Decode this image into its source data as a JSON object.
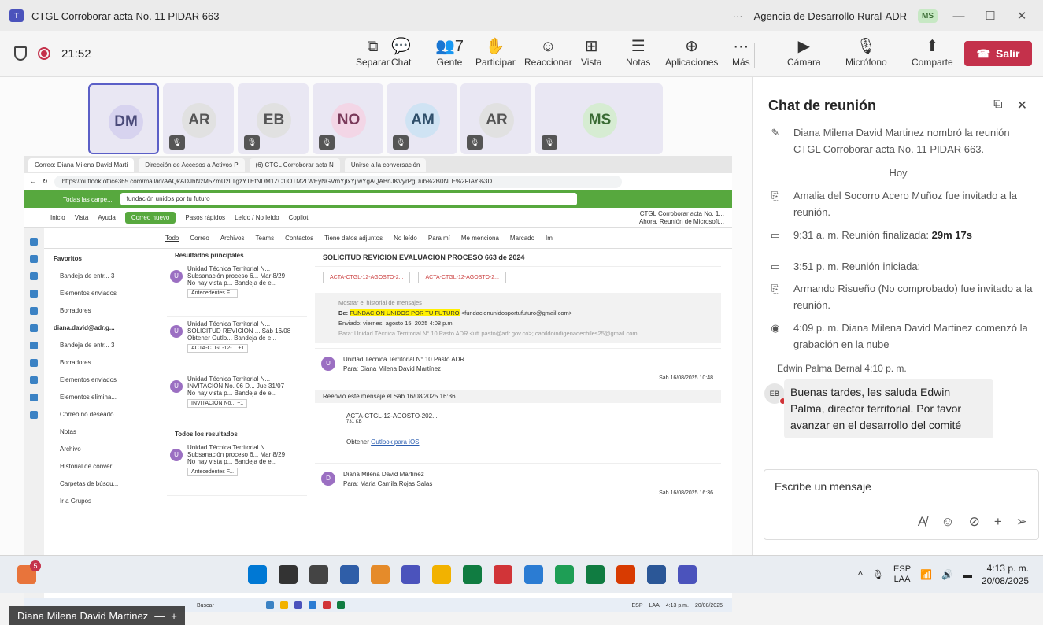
{
  "window": {
    "title": "CTGL Corroborar acta No. 11 PIDAR 663",
    "more": "···",
    "org": "Agencia de Desarrollo Rural-ADR",
    "user_initials": "MS",
    "minimize": "—",
    "maximize": "☐",
    "close": "✕"
  },
  "toolbar": {
    "time": "21:52",
    "buttons": [
      {
        "icon": "⧉",
        "label": "Separar"
      },
      {
        "icon": "💬",
        "label": "Chat"
      },
      {
        "icon": "👥7",
        "label": "Gente"
      },
      {
        "icon": "✋",
        "label": "Participar"
      },
      {
        "icon": "☺",
        "label": "Reaccionar"
      },
      {
        "icon": "⊞",
        "label": "Vista"
      },
      {
        "icon": "☰",
        "label": "Notas"
      },
      {
        "icon": "⊕",
        "label": "Aplicaciones"
      },
      {
        "icon": "···",
        "label": "Más"
      }
    ],
    "devices": [
      {
        "icon": "▶",
        "label": "Cámara"
      },
      {
        "icon": "🎙",
        "label": "Micrófono"
      },
      {
        "icon": "⬆",
        "label": "Comparte"
      }
    ],
    "leave_label": "Salir",
    "leave_color": "#c4314b"
  },
  "participants": [
    {
      "initials": "DM",
      "bg": "#d7d3ef",
      "fg": "#4b4b7a",
      "muted": false
    },
    {
      "initials": "AR",
      "bg": "#e1e1e1",
      "fg": "#555555",
      "muted": true
    },
    {
      "initials": "EB",
      "bg": "#e1e1e1",
      "fg": "#555555",
      "muted": true
    },
    {
      "initials": "NO",
      "bg": "#f3d6e6",
      "fg": "#7a3a5a",
      "muted": true
    },
    {
      "initials": "AM",
      "bg": "#cfe3f3",
      "fg": "#2f4f6a",
      "muted": true
    },
    {
      "initials": "AR",
      "bg": "#e1e1e1",
      "fg": "#555555",
      "muted": true
    },
    {
      "initials": "MS",
      "bg": "#d6ecd2",
      "fg": "#3a6b34",
      "muted": true
    }
  ],
  "share": {
    "browser_tabs": [
      "Correo: Diana Milena David Marti",
      "Dirección de Accesos a Activos P",
      "(6) CTGL Corroborar acta N",
      "Unirse a la conversación"
    ],
    "url": "https://outlook.office365.com/mail/id/AAQkADJhNzM5ZmUzLTgzYTEtNDM1ZC1iOTM2LWEyNGVmYjIxYjlwYgAQABnJKVyrPgUub%2B0NLE%2FIAY%3D",
    "folder_scope": "Todas las carpe...",
    "search_query": "fundación unidos por tu futuro",
    "meeting_notice": "CTGL Corroborar acta No. 1...",
    "meeting_notice_sub": "Ahora, Reunión de Microsoft...",
    "menu": [
      "Inicio",
      "Vista",
      "Ayuda"
    ],
    "new_mail": "Correo nuevo",
    "ribbon": [
      "Pasos rápidos",
      "Leído / No leído",
      "Copilot"
    ],
    "filters": [
      "Todo",
      "Correo",
      "Archivos",
      "Teams",
      "Contactos",
      "Tiene datos adjuntos",
      "No leído",
      "Para mí",
      "Me menciona",
      "Marcado",
      "Im"
    ],
    "folders": [
      {
        "label": "Favoritos",
        "hdr": true
      },
      {
        "label": "Bandeja de entr...  3"
      },
      {
        "label": "Elementos enviados"
      },
      {
        "label": "Borradores"
      },
      {
        "label": "diana.david@adr.g...",
        "hdr": true
      },
      {
        "label": "Bandeja de entr...  3"
      },
      {
        "label": "Borradores"
      },
      {
        "label": "Elementos enviados"
      },
      {
        "label": "Elementos elimina..."
      },
      {
        "label": "Correo no deseado"
      },
      {
        "label": "Notas"
      },
      {
        "label": "Archivo"
      },
      {
        "label": "Historial de conver..."
      },
      {
        "label": "Carpetas de búsqu..."
      },
      {
        "label": "Ir a Grupos"
      }
    ],
    "results_header": "Resultados principales",
    "all_results_header": "Todos los resultados",
    "mails": [
      {
        "from": "Unidad Técnica Territorial N...",
        "subject": "Subsanación proceso 6...   Mar 8/29",
        "preview": "No hay vista p...   Bandeja de e...",
        "att": "Antecedentes F..."
      },
      {
        "from": "Unidad Técnica Territorial N...",
        "subject": "SOLICITUD REVICION ...   Sáb 16/08",
        "preview": "Obtener Outlo...   Bandeja de e...",
        "att": "ACTA-CTGL-12-...   +1"
      },
      {
        "from": "Unidad Técnica Territorial N...",
        "subject": "INVITACIÓN No. 06 D...   Jue 31/07",
        "preview": "No hay vista p...   Bandeja de e...",
        "att": "INVITACIÓN No...   +1"
      },
      {
        "from": "Unidad Técnica Territorial N...",
        "subject": "Subsanación proceso 6...   Mar 8/29",
        "preview": "No hay vista p...   Bandeja de e...",
        "att": "Antecedentes F..."
      }
    ],
    "reader": {
      "subject": "SOLICITUD REVICION EVALUACION PROCESO 663 de 2024",
      "attachments": [
        "ACTA-CTGL-12-AGOSTO-2...",
        "ACTA-CTGL-12-AGOSTO-2..."
      ],
      "history": "Mostrar el historial de mensajes",
      "from_label": "De:",
      "from_name": "FUNDACION UNIDOS POR TU FUTURO",
      "from_email": "<fundacionunidosportufuturo@gmail.com>",
      "sent": "Enviado: viernes, agosto 15, 2025 4:08 p.m.",
      "to": "Para: Unidad Técnica Territorial N° 10 Pasto ADR <utt.pasto@adr.gov.co>; cabildoindigenadechiles25@gmail.com",
      "msg1_from": "Unidad Técnica Territorial N° 10 Pasto ADR",
      "msg1_to": "Para: Diana Milena David Martínez",
      "msg1_date": "Sáb 16/08/2025 10:48",
      "forward_note": "Reenvió este mensaje el Sáb 16/08/2025 16:36.",
      "msg1_att": "ACTA-CTGL-12-AGOSTO-202...",
      "msg1_att_size": "731 KB",
      "outlook_text": "Obtener",
      "outlook_link": "Outlook para iOS",
      "msg2_from": "Diana Milena David Martínez",
      "msg2_to": "Para: Maria Camila Rojas Salas",
      "msg2_date": "Sáb 16/08/2025 16:36"
    },
    "inner_taskbar": {
      "search": "Buscar",
      "lang": "ESP",
      "region": "LAA",
      "time": "4:13 p.m.",
      "date": "20/08/2025"
    }
  },
  "speaker": {
    "name": "Diana Milena David Martinez"
  },
  "chat": {
    "title": "Chat de reunión",
    "events": [
      {
        "icon": "✎",
        "text": "Diana Milena David Martinez nombró la reunión CTGL Corroborar acta No. 11 PIDAR 663.",
        "bold": ""
      },
      {
        "icon": "⎘",
        "text": "Amalia del Socorro Acero Muñoz fue invitado a la reunión.",
        "bold": ""
      },
      {
        "icon": "▭",
        "text": "9:31 a. m.   Reunión finalizada: ",
        "bold": "29m 17s"
      },
      {
        "icon": "▭",
        "text": "3:51 p. m.   Reunión iniciada:",
        "bold": ""
      },
      {
        "icon": "⎘",
        "text": "Armando Risueño (No comprobado) fue invitado a la reunión.",
        "bold": ""
      },
      {
        "icon": "◉",
        "text": "4:09 p. m.   Diana Milena David Martinez comenzó la grabación en la nube",
        "bold": ""
      }
    ],
    "today": "Hoy",
    "sender": "Edwin Palma Bernal   4:10 p. m.",
    "sender_initials": "EB",
    "message": "Buenas tardes, les saluda Edwin Palma, director territorial. Por favor avanzar en el desarrollo del comité",
    "compose_placeholder": "Escribe un mensaje"
  },
  "taskbar": {
    "notification_count": "5",
    "lang": "ESP",
    "region": "LAA",
    "time": "4:13 p. m.",
    "date": "20/08/2025"
  }
}
